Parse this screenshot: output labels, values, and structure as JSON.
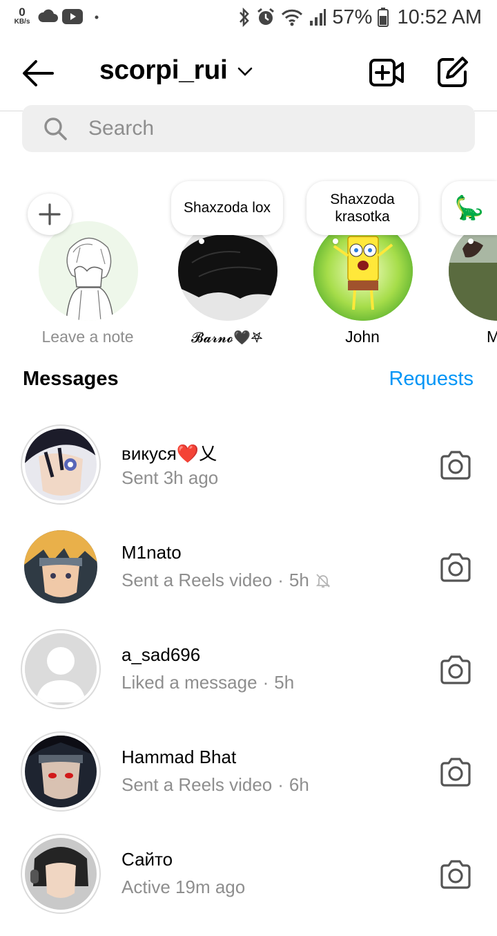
{
  "status_bar": {
    "net_speed_value": "0",
    "net_speed_unit": "KB/s",
    "battery": "57%",
    "time": "10:52 AM"
  },
  "header": {
    "username": "scorpi_rui"
  },
  "search": {
    "placeholder": "Search"
  },
  "notes": [
    {
      "label": "Leave a note",
      "bubble": ""
    },
    {
      "label": "𝓑𝓪𝓻𝓷𝓸🖤𖤐",
      "bubble": "Shaxzoda lox"
    },
    {
      "label": "John",
      "bubble": "Shaxzoda krasotka"
    },
    {
      "label": "Me",
      "bubble": "🦕"
    }
  ],
  "messages": {
    "title": "Messages",
    "requests": "Requests",
    "threads": [
      {
        "name": "викуся❤️乂",
        "subtitle": "Sent 3h ago",
        "time": ""
      },
      {
        "name": "M1nato",
        "subtitle": "Sent a Reels video",
        "time": "5h",
        "muted": true
      },
      {
        "name": "a_sad696",
        "subtitle": "Liked a message",
        "time": "5h"
      },
      {
        "name": "Hammad Bhat",
        "subtitle": "Sent a Reels video",
        "time": "6h"
      },
      {
        "name": "Сайто",
        "subtitle": "Active 19m ago",
        "time": ""
      }
    ]
  },
  "colors": {
    "accent": "#0095f6",
    "secondary_text": "#8e8e8e",
    "search_bg": "#efefef"
  },
  "icons": [
    "back-arrow-icon",
    "chevron-down-icon",
    "video-call-icon",
    "compose-icon",
    "search-icon",
    "camera-icon",
    "muted-bell-icon",
    "plus-icon"
  ]
}
